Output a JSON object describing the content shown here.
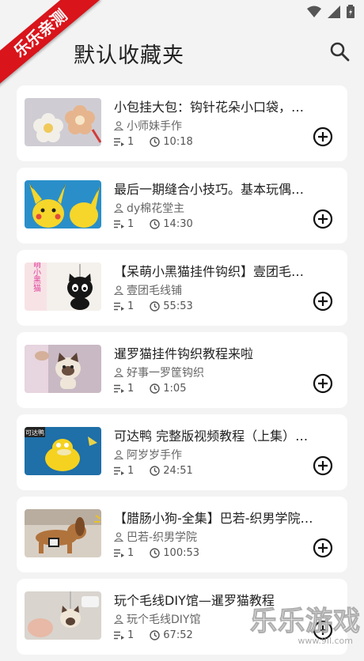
{
  "app_bar": {
    "title": "默认收藏夹"
  },
  "ribbon_text": "乐乐亲测",
  "videos": [
    {
      "title": "小包挂大包：钩针花朵小口袋，…",
      "author": "小师妹手作",
      "count": "1",
      "duration": "10:18"
    },
    {
      "title": "最后一期缝合小技巧。基本玩偶…",
      "author": "dy棉花堂主",
      "count": "1",
      "duration": "14:30"
    },
    {
      "title": "【呆萌小黑猫挂件钩织】壹团毛…",
      "author": "壹团毛线铺",
      "count": "1",
      "duration": "55:53"
    },
    {
      "title": "暹罗猫挂件钩织教程来啦",
      "author": "好事一罗筐钩织",
      "count": "1",
      "duration": "1:05"
    },
    {
      "title": "可达鸭 完整版视频教程（上集）…",
      "author": "阿岁岁手作",
      "count": "1",
      "duration": "24:51"
    },
    {
      "title": "【腊肠小狗-全集】巴若-织男学院…",
      "author": "巴若-织男学院",
      "count": "1",
      "duration": "100:53"
    },
    {
      "title": "玩个毛线DIY馆—暹罗猫教程",
      "author": "玩个毛线DIY馆",
      "count": "1",
      "duration": "67:52"
    }
  ],
  "thumb_text": {
    "t3_side": "软萌小黑猫",
    "t5_tag": "可达鸭"
  },
  "watermark": {
    "main": "乐乐游戏",
    "sub": "www.9ll.com"
  }
}
